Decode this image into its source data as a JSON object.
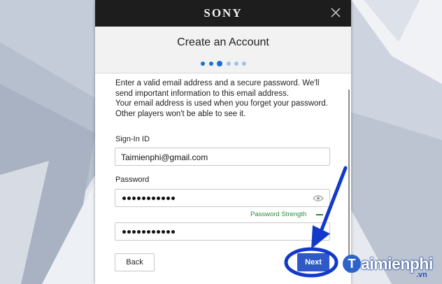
{
  "header": {
    "logo_text": "SONY"
  },
  "dialog": {
    "title": "Create an Account",
    "steps_total": 6,
    "current_step": 3
  },
  "form": {
    "intro_line1": "Enter a valid email address and a secure password. We'll send important information to this email address.",
    "intro_line2": "Your email address is used when you forget your password. Other players won't be able to see it.",
    "signin_label": "Sign-In ID",
    "signin_value": "Taimienphi@gmail.com",
    "password_label": "Password",
    "password_mask_count": 11,
    "confirm_mask_count": 11,
    "strength_label": "Password Strength"
  },
  "buttons": {
    "back": "Back",
    "next": "Next"
  },
  "watermark": {
    "initial": "T",
    "name": "aimienphi",
    "suffix": ".vn"
  },
  "colors": {
    "header_bg": "#1d1d1d",
    "accent": "#1b6fd0",
    "next_button": "#2e59c7",
    "strength_green": "#2e8b3d",
    "annotation_blue": "#1239c9"
  }
}
